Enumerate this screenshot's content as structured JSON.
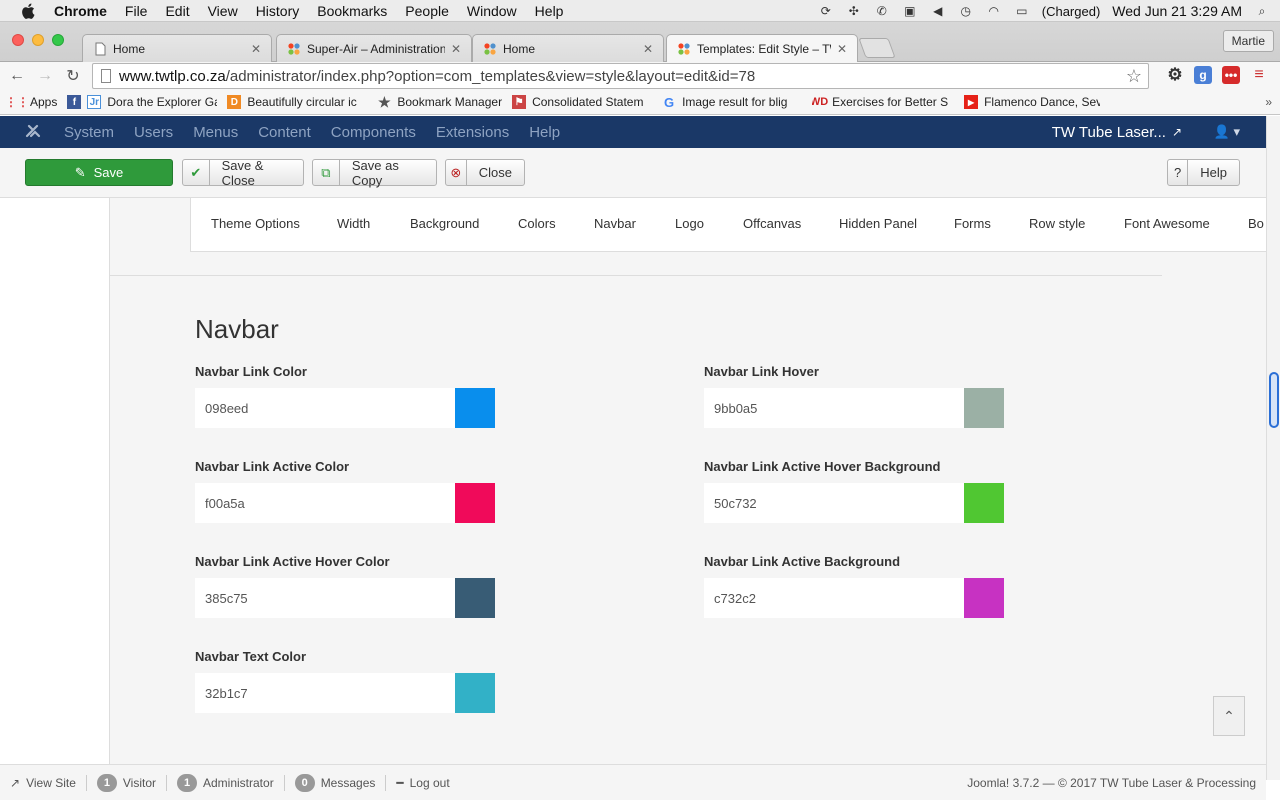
{
  "mac_menubar": {
    "app_name": "Chrome",
    "menus": [
      "File",
      "Edit",
      "View",
      "History",
      "Bookmarks",
      "People",
      "Window",
      "Help"
    ],
    "battery_status": "(Charged)",
    "datetime": "Wed Jun 21  3:29 AM"
  },
  "browser": {
    "tabs": [
      {
        "label": "Home"
      },
      {
        "label": "Super-Air – Administration"
      },
      {
        "label": "Home"
      },
      {
        "label": "Templates: Edit Style – TW"
      }
    ],
    "profile_name": "Martie",
    "url_host": "www.twtlp.co.za",
    "url_path": "/administrator/index.php?option=com_templates&view=style&layout=edit&id=78",
    "bookmarks": [
      {
        "label": "Apps"
      },
      {
        "label": "Dora the Explorer Ga"
      },
      {
        "label": "Beautifully circular ic"
      },
      {
        "label": "Bookmark Manager"
      },
      {
        "label": "Consolidated Statem"
      },
      {
        "label": "Image result for blig"
      },
      {
        "label": "Exercises for Better S"
      },
      {
        "label": "Flamenco Dance, Sev"
      }
    ]
  },
  "joomla_nav": {
    "menus": [
      "System",
      "Users",
      "Menus",
      "Content",
      "Components",
      "Extensions",
      "Help"
    ],
    "site_name": "TW Tube Laser..."
  },
  "toolbar": {
    "save_label": "Save",
    "save_close_label": "Save & Close",
    "save_copy_label": "Save as Copy",
    "close_label": "Close",
    "help_label": "Help"
  },
  "settings_tabs": [
    "Theme Options",
    "Width",
    "Background",
    "Colors",
    "Navbar",
    "Logo",
    "Offcanvas",
    "Hidden Panel",
    "Forms",
    "Row style",
    "Font Awesome",
    "Bo"
  ],
  "section_title": "Navbar",
  "fields": [
    {
      "label": "Navbar Link Color",
      "value": "098eed",
      "color": "#098eed"
    },
    {
      "label": "Navbar Link Hover",
      "value": "9bb0a5",
      "color": "#9bb0a5"
    },
    {
      "label": "Navbar Link Active Color",
      "value": "f00a5a",
      "color": "#f00a5a"
    },
    {
      "label": "Navbar Link Active Hover Background",
      "value": "50c732",
      "color": "#50c732"
    },
    {
      "label": "Navbar Link Active Hover Color",
      "value": "385c75",
      "color": "#385c75"
    },
    {
      "label": "Navbar Link Active Background",
      "value": "c732c2",
      "color": "#c732c2"
    },
    {
      "label": "Navbar Text Color",
      "value": "32b1c7",
      "color": "#32b1c7"
    }
  ],
  "statusbar": {
    "view_site": "View Site",
    "visitor_count": "1",
    "visitor_label": "Visitor",
    "admin_count": "1",
    "admin_label": "Administrator",
    "messages_count": "0",
    "messages_label": "Messages",
    "logout_label": "Log out",
    "footer_text": "Joomla! 3.7.2  —  © 2017 TW Tube Laser & Processing"
  },
  "colors": {
    "joomla_nav_bg": "#1a3867",
    "save_button": "#2f9a3b"
  }
}
